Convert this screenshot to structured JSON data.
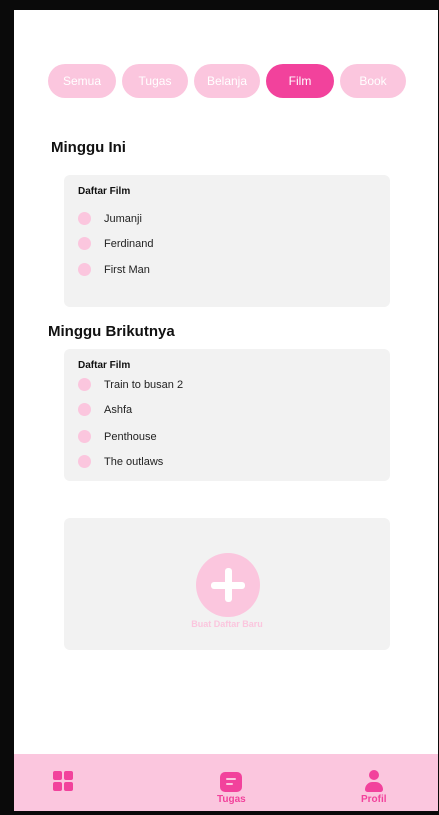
{
  "filters": [
    {
      "label": "Semua",
      "active": false
    },
    {
      "label": "Tugas",
      "active": false
    },
    {
      "label": "Belanja",
      "active": false
    },
    {
      "label": "Film",
      "active": true
    },
    {
      "label": "Book",
      "active": false
    }
  ],
  "this_week": {
    "heading": "Minggu Ini",
    "list_title": "Daftar Film",
    "items": [
      "Jumanji",
      "Ferdinand",
      "First Man"
    ]
  },
  "next_week": {
    "heading": "Minggu Brikutnya",
    "list_title": "Daftar Film",
    "items": [
      "Train to busan 2",
      "Ashfa",
      "Penthouse",
      "The outlaws"
    ]
  },
  "new_list": {
    "label": "Buat Daftar Baru"
  },
  "bottom_nav": {
    "home_icon": "grid-icon",
    "tasks_label": "Tugas",
    "profile_label": "Profil"
  },
  "colors": {
    "accent": "#f2429c",
    "accent_light": "#fbc6de",
    "card_bg": "#f2f2f2"
  }
}
